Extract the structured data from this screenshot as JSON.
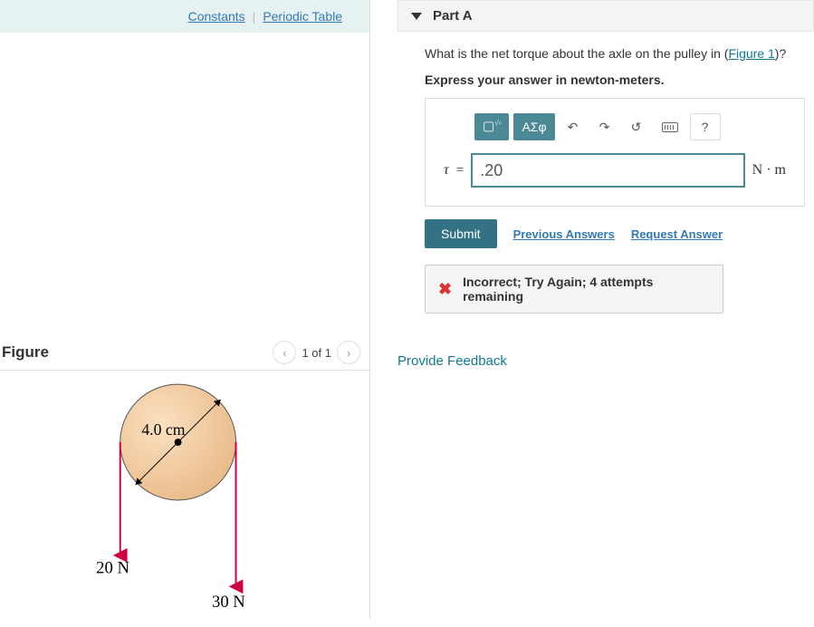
{
  "constants": {
    "constants": "Constants",
    "sep": "|",
    "periodic": "Periodic Table"
  },
  "figure": {
    "title": "Figure",
    "counter": "1 of 1",
    "diameter_label": "4.0 cm",
    "left_force": "20 N",
    "right_force": "30 N"
  },
  "part": {
    "header": "Part A",
    "question_pre": "What is the net torque about the axle on the pulley in (",
    "figure_link": "Figure 1",
    "question_post": ")?",
    "instruction": "Express your answer in newton-meters.",
    "variable": "τ",
    "equals": "=",
    "value": ".20",
    "units": "N · m",
    "toolbar": {
      "greek": "ΑΣφ",
      "help": "?"
    },
    "submit": "Submit",
    "prev": "Previous Answers",
    "request": "Request Answer",
    "feedback": "Incorrect; Try Again; 4 attempts remaining"
  },
  "provide_feedback": "Provide Feedback"
}
